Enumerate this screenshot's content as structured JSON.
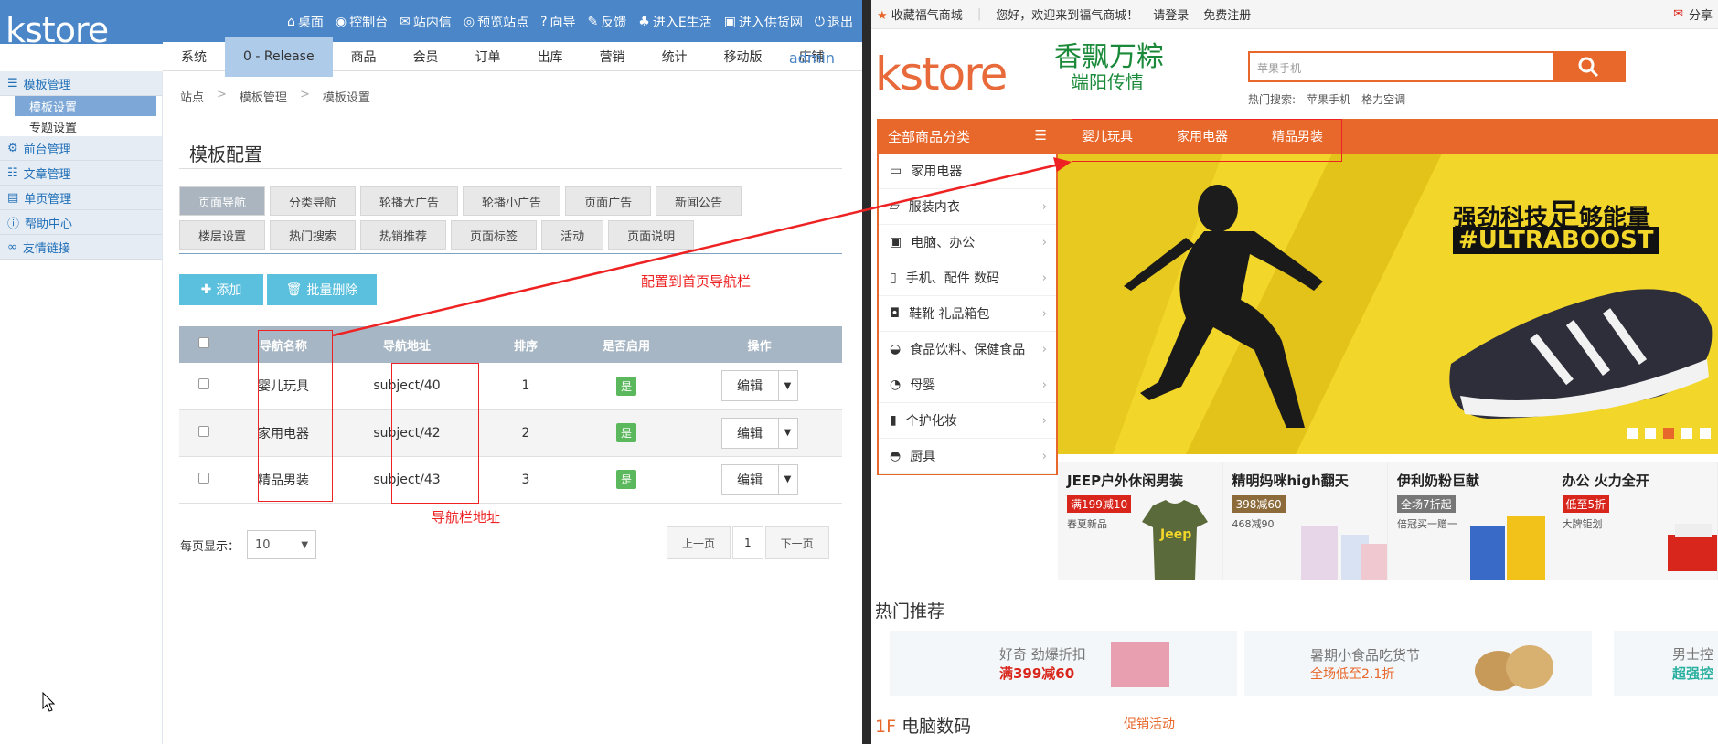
{
  "admin": {
    "logo": "kstore",
    "top_links": [
      "桌面",
      "控制台",
      "站内信",
      "预览站点",
      "向导",
      "反馈",
      "进入E生活",
      "进入供货网",
      "退出"
    ],
    "nav_items": [
      "系统",
      "0 - Release",
      "商品",
      "会员",
      "订单",
      "出库",
      "营销",
      "统计",
      "移动版",
      "店铺"
    ],
    "admin_user": "admin",
    "sidebar": [
      {
        "label": "模板管理",
        "children": [
          "模板设置",
          "专题设置"
        ]
      },
      {
        "label": "前台管理"
      },
      {
        "label": "文章管理"
      },
      {
        "label": "单页管理"
      },
      {
        "label": "帮助中心"
      },
      {
        "label": "友情链接"
      }
    ],
    "breadcrumb": [
      "站点",
      "模板管理",
      "模板设置"
    ],
    "page_title": "模板配置",
    "tabs_row1": [
      "页面导航",
      "分类导航",
      "轮播大广告",
      "轮播小广告",
      "页面广告",
      "新闻公告"
    ],
    "tabs_row2": [
      "楼层设置",
      "热门搜索",
      "热销推荐",
      "页面标签",
      "活动",
      "页面说明"
    ],
    "add_label": "添加",
    "bulk_delete_label": "批量删除",
    "table": {
      "headers": [
        "导航名称",
        "导航地址",
        "排序",
        "是否启用",
        "操作"
      ],
      "rows": [
        {
          "name": "婴儿玩具",
          "url": "subject/40",
          "order": "1",
          "enabled": "是",
          "action": "编辑"
        },
        {
          "name": "家用电器",
          "url": "subject/42",
          "order": "2",
          "enabled": "是",
          "action": "编辑"
        },
        {
          "name": "精品男装",
          "url": "subject/43",
          "order": "3",
          "enabled": "是",
          "action": "编辑"
        }
      ]
    },
    "per_page_label": "每页显示：",
    "per_page_value": "10",
    "pager": {
      "prev": "上一页",
      "current": "1",
      "next": "下一页"
    },
    "annotation_nav": "配置到首页导航栏",
    "annotation_url": "导航栏地址",
    "accent_color": "#4a86c8"
  },
  "store": {
    "topbar": [
      "收藏福气商城",
      "您好，欢迎来到福气商城！",
      "请登录",
      "免费注册"
    ],
    "topbar_right": "分享",
    "logo": "kstore",
    "promo_line1": "香飘万粽",
    "promo_line2": "端阳传情",
    "search_placeholder": "苹果手机",
    "hot_label": "热门搜索:",
    "hot_terms": [
      "苹果手机",
      "格力空调"
    ],
    "all_categories": "全部商品分类",
    "nav_links": [
      "婴儿玩具",
      "家用电器",
      "精品男装"
    ],
    "categories": [
      "家用电器",
      "服装内衣",
      "电脑、办公",
      "手机、配件  数码",
      "鞋靴  礼品箱包",
      "食品饮料、保健食品",
      "母婴",
      "个护化妆",
      "厨具"
    ],
    "banner_line1": "强劲科技",
    "banner_big": "足",
    "banner_line1b": "够能量",
    "banner_line2": "#ULTRABOOST",
    "tiles": [
      {
        "title": "JEEP户外休闲男装",
        "tag": "满199减10",
        "sub": "春夏新品",
        "tag_color": "#d9261c"
      },
      {
        "title": "精明妈咪high翻天",
        "tag": "398减60",
        "sub": "468减90",
        "tag_color": "#8c6a3a"
      },
      {
        "title": "伊利奶粉巨献",
        "tag": "全场7折起",
        "sub": "倍冠买一赠一",
        "tag_color": "#777"
      },
      {
        "title": "办公 火力全开",
        "tag": "低至5折",
        "sub": "大牌钜划",
        "tag_color": "#d9261c"
      }
    ],
    "hot_rec_title": "热门推荐",
    "rec": [
      {
        "line1": "好奇 劲爆折扣",
        "line2": "满399减60"
      },
      {
        "line1": "暑期小食品吃货节",
        "line2": "全场低至2.1折"
      },
      {
        "line1": "男士控",
        "line2": "超强控"
      }
    ],
    "floor_num": "1F",
    "floor_title": "电脑数码",
    "floor_tab": "促销活动",
    "accent_color": "#e8672a"
  }
}
